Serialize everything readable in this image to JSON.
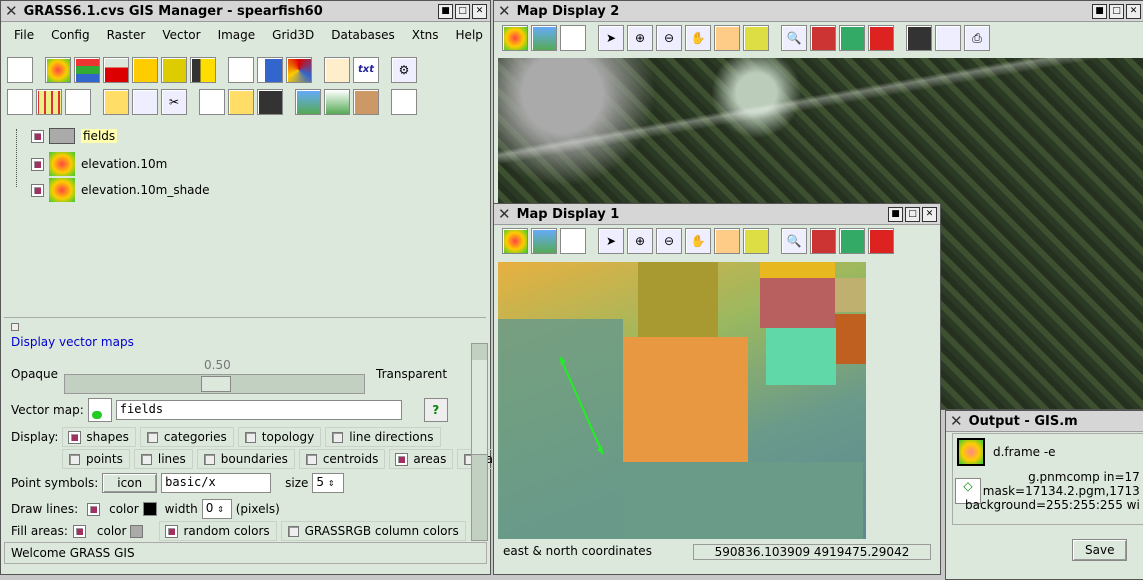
{
  "manager": {
    "title": "GRASS6.1.cvs GIS Manager - spearfish60",
    "menu": [
      "File",
      "Config",
      "Raster",
      "Vector",
      "Image",
      "Grid3D",
      "Databases",
      "Xtns",
      "Help"
    ],
    "layers": [
      {
        "name": "fields",
        "checked": true,
        "selected": true
      },
      {
        "name": "elevation.10m",
        "checked": true
      },
      {
        "name": "elevation.10m_shade",
        "checked": true
      }
    ],
    "panel": {
      "heading": "Display vector maps",
      "opaque": "Opaque",
      "transparent": "Transparent",
      "opacity_value": "0.50",
      "opacity": 0.5,
      "vector_label": "Vector map:",
      "vector_value": "fields",
      "display_label": "Display:",
      "display_opts1": [
        {
          "label": "shapes",
          "on": true
        },
        {
          "label": "categories",
          "on": false
        },
        {
          "label": "topology",
          "on": false
        },
        {
          "label": "line directions",
          "on": false
        }
      ],
      "display_opts2": [
        {
          "label": "points",
          "on": false
        },
        {
          "label": "lines",
          "on": false
        },
        {
          "label": "boundaries",
          "on": false
        },
        {
          "label": "centroids",
          "on": false
        },
        {
          "label": "areas",
          "on": true
        },
        {
          "label": "faces",
          "on": false
        }
      ],
      "point_label": "Point symbols:",
      "icon_btn": "icon",
      "symbol_value": "basic/x",
      "size_label": "size",
      "size_value": "5",
      "draw_label": "Draw lines:",
      "color_label": "color",
      "width_label": "width",
      "width_value": "0",
      "pixels_label": "(pixels)",
      "fill_label": "Fill areas:",
      "random_label": "random colors",
      "grassrgb_label": "GRASSRGB column colors"
    },
    "status": "Welcome GRASS GIS"
  },
  "display2": {
    "title": "Map Display 2"
  },
  "display1": {
    "title": "Map Display 1",
    "coords_label": "east & north coordinates",
    "coords_value": "590836.103909 4919475.29042"
  },
  "output": {
    "title": "Output - GIS.m",
    "cmd1": "d.frame -e",
    "cmd2_l1": "g.pnmcomp in=17",
    "cmd2_l2": "mask=17134.2.pgm,1713",
    "cmd2_l3": "background=255:255:255 wi",
    "save": "Save"
  },
  "colors": {
    "bg": "#dde8dc",
    "check": "#a23060",
    "link": "#0000cc"
  }
}
